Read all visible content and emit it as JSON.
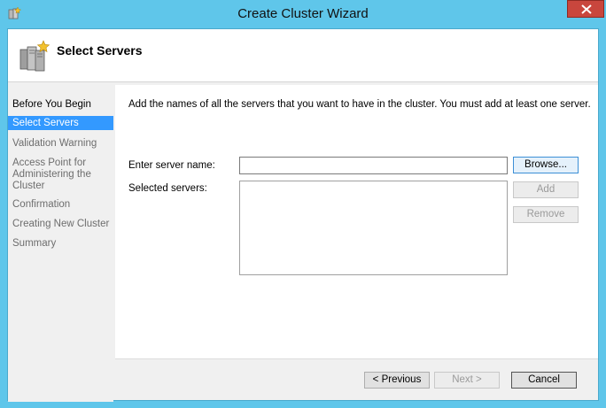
{
  "window": {
    "title": "Create Cluster Wizard"
  },
  "header": {
    "title": "Select Servers"
  },
  "sidebar": {
    "items": [
      {
        "label": "Before You Begin",
        "state": "done"
      },
      {
        "label": "Select Servers",
        "state": "active"
      },
      {
        "label": "Validation Warning",
        "state": "pending"
      },
      {
        "label": "Access Point for\nAdministering the\nCluster",
        "state": "pending"
      },
      {
        "label": "Confirmation",
        "state": "pending"
      },
      {
        "label": "Creating New Cluster",
        "state": "pending"
      },
      {
        "label": "Summary",
        "state": "pending"
      }
    ]
  },
  "main": {
    "description": "Add the names of all the servers that you want to have in the cluster. You must add at least one server.",
    "server_name_label": "Enter server name:",
    "server_name_value": "",
    "selected_servers_label": "Selected servers:",
    "selected_servers": [],
    "browse_label": "Browse...",
    "add_label": "Add",
    "remove_label": "Remove"
  },
  "footer": {
    "previous_label": "< Previous",
    "next_label": "Next >",
    "cancel_label": "Cancel"
  },
  "colors": {
    "title_bar": "#5fc6ea",
    "close_button": "#c9463d",
    "nav_active": "#3399ff",
    "nav_pending_text": "#6d6d6d"
  }
}
